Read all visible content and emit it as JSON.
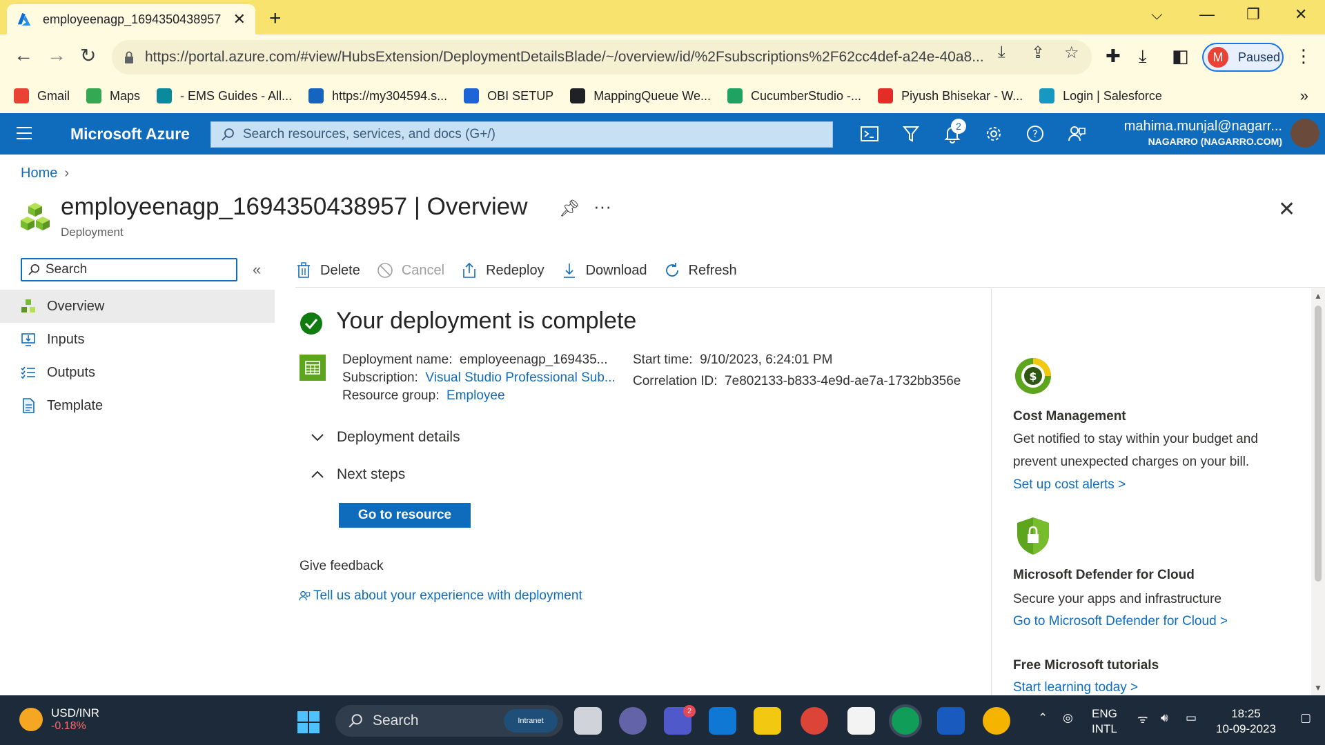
{
  "browser": {
    "tab_title": "employeenagp_1694350438957",
    "url": "https://portal.azure.com/#view/HubsExtension/DeploymentDetailsBlade/~/overview/id/%2Fsubscriptions%2F62cc4def-a24e-40a8...",
    "profile_initial": "M",
    "profile_status": "Paused",
    "bookmarks": [
      {
        "label": "Gmail",
        "color": "#ea4335"
      },
      {
        "label": "Maps",
        "color": "#34a853"
      },
      {
        "label": "- EMS Guides - All...",
        "color": "#0b8a9c"
      },
      {
        "label": "https://my304594.s...",
        "color": "#1565c0"
      },
      {
        "label": "OBI SETUP",
        "color": "#1e63d8"
      },
      {
        "label": "MappingQueue We...",
        "color": "#202124"
      },
      {
        "label": "CucumberStudio -...",
        "color": "#1ea362"
      },
      {
        "label": "Piyush Bhisekar - W...",
        "color": "#e52d27"
      },
      {
        "label": "Login | Salesforce",
        "color": "#1798c1"
      }
    ],
    "bookmarks_more": "»"
  },
  "azure": {
    "brand": "Microsoft Azure",
    "search_placeholder": "Search resources, services, and docs (G+/)",
    "notification_count": "2",
    "account_email": "mahima.munjal@nagarr...",
    "account_org": "NAGARRO (NAGARRO.COM)"
  },
  "page": {
    "breadcrumb_home": "Home",
    "title": "employeenagp_1694350438957 | Overview",
    "subtitle": "Deployment"
  },
  "sidebar": {
    "search_placeholder": "Search",
    "collapse_glyph": "«",
    "items": [
      {
        "label": "Overview"
      },
      {
        "label": "Inputs"
      },
      {
        "label": "Outputs"
      },
      {
        "label": "Template"
      }
    ]
  },
  "commands": {
    "delete": "Delete",
    "cancel": "Cancel",
    "redeploy": "Redeploy",
    "download": "Download",
    "refresh": "Refresh"
  },
  "deployment": {
    "status_title": "Your deployment is complete",
    "name_label": "Deployment name:",
    "name_value": "employeenagp_169435...",
    "subscription_label": "Subscription:",
    "subscription_value": "Visual Studio Professional Sub...",
    "resource_group_label": "Resource group:",
    "resource_group_value": "Employee",
    "start_time_label": "Start time:",
    "start_time_value": "9/10/2023, 6:24:01 PM",
    "correlation_label": "Correlation ID:",
    "correlation_value": "7e802133-b833-4e9d-ae7a-1732bb356e",
    "details_section": "Deployment details",
    "next_steps_section": "Next steps",
    "go_to_resource": "Go to resource",
    "feedback_heading": "Give feedback",
    "feedback_link": "Tell us about your experience with deployment"
  },
  "right_panel": {
    "cost": {
      "title": "Cost Management",
      "text": "Get notified to stay within your budget and prevent unexpected charges on your bill.",
      "link": "Set up cost alerts >"
    },
    "defender": {
      "title": "Microsoft Defender for Cloud",
      "text": "Secure your apps and infrastructure",
      "link": "Go to Microsoft Defender for Cloud >"
    },
    "tutorials": {
      "title": "Free Microsoft tutorials",
      "link": "Start learning today >"
    }
  },
  "taskbar": {
    "ticker_symbol": "USD/INR",
    "ticker_change": "-0.18%",
    "search_label": "Search",
    "search_pill": "Intranet",
    "teams_badge": "2",
    "lang_line1": "ENG",
    "lang_line2": "INTL",
    "time": "18:25",
    "date": "10-09-2023"
  }
}
